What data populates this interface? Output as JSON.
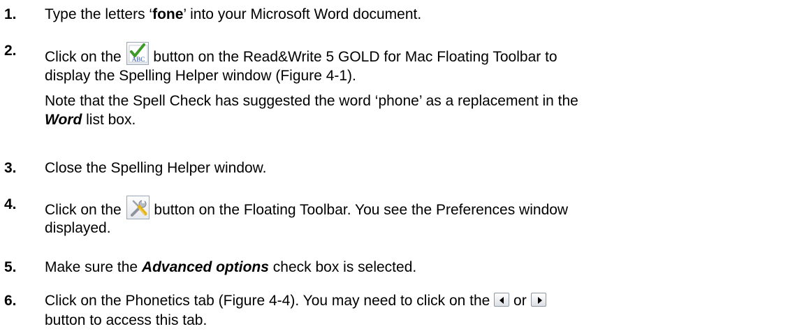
{
  "steps": [
    {
      "number": "1.",
      "pre": "Type the letters ‘",
      "bold": "fone",
      "post": "’ into your Microsoft Word document."
    },
    {
      "number": "2.",
      "line1_pre": "Click on the ",
      "line1_post": " button on the Read&Write 5 GOLD for Mac Floating Toolbar to",
      "line2": "display the Spelling Helper window (Figure 4-1).",
      "note_line1": "Note that the Spell Check has suggested the word ‘phone’ as a replacement in the",
      "note_bold": "Word",
      "note_post": " list box.",
      "icon": "spell-check-abc-icon",
      "icon_text": "ABC"
    },
    {
      "number": "3.",
      "text": "Close the Spelling Helper window."
    },
    {
      "number": "4.",
      "line1_pre": "Click on the ",
      "line1_post": " button on the Floating Toolbar. You see the Preferences window",
      "line2": "displayed.",
      "icon": "preferences-tools-icon"
    },
    {
      "number": "5.",
      "pre": "Make sure the ",
      "bold": "Advanced options",
      "post": " check box is selected."
    },
    {
      "number": "6.",
      "line1_pre": "Click on the Phonetics tab (Figure 4-4). You may need to click on the ",
      "mid": " or ",
      "line2": "button to access this tab.",
      "icon_left": "scroll-left-arrow-icon",
      "icon_right": "scroll-right-arrow-icon"
    }
  ],
  "colors": {
    "text": "#000000",
    "check_green": "#3f9a2a",
    "abc_blue": "#2f4f9e"
  }
}
